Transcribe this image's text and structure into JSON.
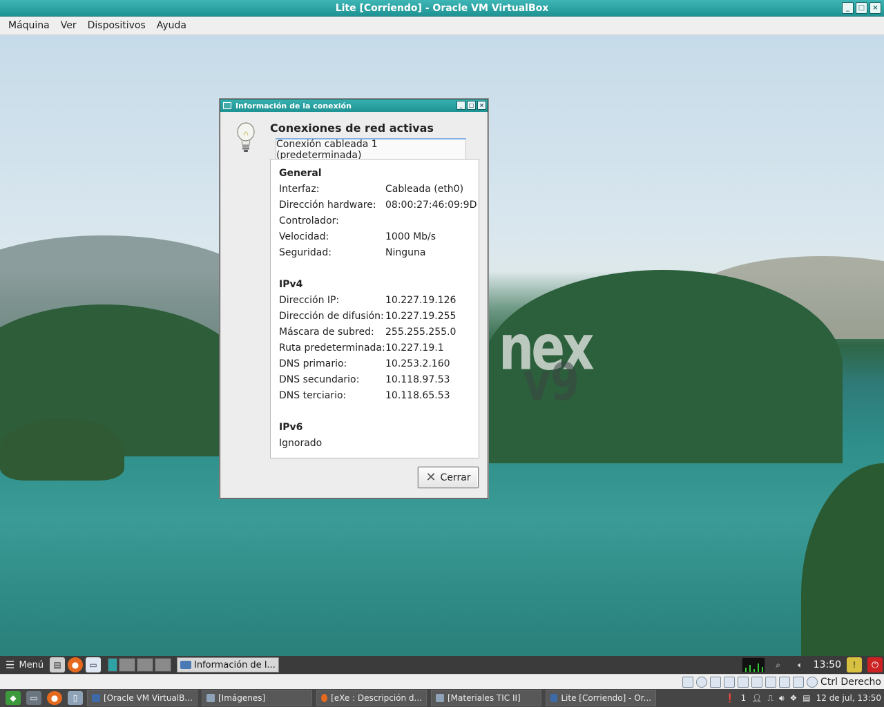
{
  "host_window": {
    "title": "Lite [Corriendo] - Oracle VM VirtualBox",
    "controls": [
      "_",
      "□",
      "×"
    ]
  },
  "vbox_menu": [
    "Máquina",
    "Ver",
    "Dispositivos",
    "Ayuda"
  ],
  "desktop": {
    "watermark_text": "nex",
    "watermark_version": "v9"
  },
  "dialog": {
    "title": "Información de la conexión",
    "controls": [
      "_",
      "□",
      "×"
    ],
    "heading": "Conexiones de red activas",
    "tab": "Conexión cableada 1 (predeterminada)",
    "general": {
      "title": "General",
      "rows": [
        {
          "k": "Interfaz:",
          "v": "Cableada (eth0)"
        },
        {
          "k": "Dirección hardware:",
          "v": "08:00:27:46:09:9D"
        },
        {
          "k": "Controlador:",
          "v": ""
        },
        {
          "k": "Velocidad:",
          "v": "1000 Mb/s"
        },
        {
          "k": "Seguridad:",
          "v": "Ninguna"
        }
      ]
    },
    "ipv4": {
      "title": "IPv4",
      "rows": [
        {
          "k": "Dirección IP:",
          "v": "10.227.19.126"
        },
        {
          "k": "Dirección de difusión:",
          "v": "10.227.19.255"
        },
        {
          "k": "Máscara de subred:",
          "v": "255.255.255.0"
        },
        {
          "k": "Ruta predeterminada:",
          "v": "10.227.19.1"
        },
        {
          "k": "DNS primario:",
          "v": "10.253.2.160"
        },
        {
          "k": "DNS secundario:",
          "v": "10.118.97.53"
        },
        {
          "k": "DNS terciario:",
          "v": "10.118.65.53"
        }
      ]
    },
    "ipv6": {
      "title": "IPv6",
      "status": "Ignorado"
    },
    "close_label": "Cerrar"
  },
  "guest_panel": {
    "menu_label": "Menú",
    "task_label": "Información de l...",
    "clock": "13:50"
  },
  "vbox_status": {
    "host_key": "Ctrl Derecho"
  },
  "host_taskbar": {
    "tasks": [
      "[Oracle VM VirtualB...",
      "[Imágenes]",
      "[eXe : Descripción d...",
      "[Materiales TIC II]",
      "Lite [Corriendo] - Or..."
    ],
    "tray_count": "1",
    "datetime": "12 de jul, 13:50"
  },
  "colors": {
    "title_bar": "#1f9393",
    "close_power": "#cc2222"
  }
}
